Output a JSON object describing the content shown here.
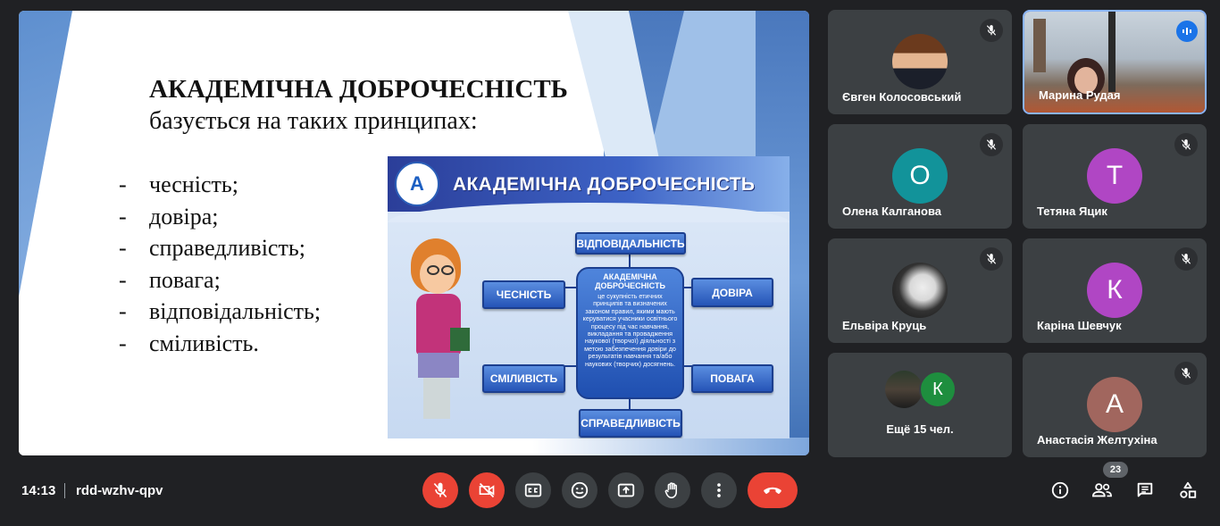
{
  "slide": {
    "title": "АКАДЕМІЧНА ДОБРОЧЕСНІСТЬ",
    "subtitle": "базується на таких принципах:",
    "bullet_marker": "-",
    "principles": [
      "чесність;",
      "довіра;",
      "справедливість;",
      "повага;",
      "відповідальність;",
      "сміливість."
    ],
    "poster": {
      "logo_glyph": "A",
      "title": "АКАДЕМІЧНА ДОБРОЧЕСНІСТЬ",
      "center_title": "АКАДЕМІЧНА ДОБРОЧЕСНІСТЬ",
      "center_text": "це сукупність етичних принципів та визначених законом правил, якими мають керуватися учасники освітнього процесу під час навчання, викладання та провадження наукової (творчої) діяльності з метою забезпечення довіри до результатів навчання та/або наукових (творчих) досягнень.",
      "boxes": {
        "top": "ВІДПОВІДАЛЬНІСТЬ",
        "left_top": "ЧЕСНІСТЬ",
        "right_top": "ДОВІРА",
        "left_bottom": "СМІЛИВІСТЬ",
        "right_bottom": "ПОВАГА",
        "bottom": "СПРАВЕДЛИВІСТЬ"
      }
    }
  },
  "participants": [
    {
      "name": "Євген Колосовський",
      "type": "photo",
      "muted": true
    },
    {
      "name": "Марина Рудая",
      "type": "video",
      "speaking": true
    },
    {
      "name": "Олена Калганова",
      "initial": "О",
      "color": "#12939a",
      "muted": true
    },
    {
      "name": "Тетяна Яцик",
      "initial": "Т",
      "color": "#b046c4",
      "muted": true
    },
    {
      "name": "Ельвіра Круць",
      "type": "photo",
      "muted": true
    },
    {
      "name": "Каріна Шевчук",
      "initial": "К",
      "color": "#b046c4",
      "muted": true
    },
    {
      "name": "Ещё 15 чел.",
      "type": "more",
      "initial": "К",
      "color": "#1e8e3e"
    },
    {
      "name": "Анастасія Желтухіна",
      "initial": "А",
      "color": "#a1665e",
      "muted": true
    }
  ],
  "bottom_bar": {
    "time": "14:13",
    "meeting_code": "rdd-wzhv-qpv",
    "people_count": "23"
  },
  "colors": {
    "background": "#202124",
    "tile": "#3c4043",
    "danger": "#ea4335",
    "speaking": "#8ab4f8"
  }
}
